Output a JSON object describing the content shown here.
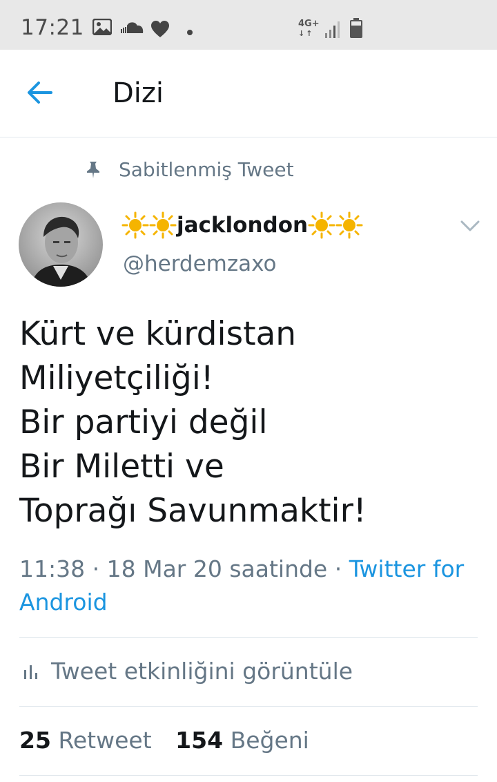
{
  "status_bar": {
    "time": "17:21",
    "network": "4G+",
    "icons": [
      "image-icon",
      "cloud-icon",
      "heart-icon",
      "dot-icon",
      "signal-icon",
      "battery-icon"
    ]
  },
  "header": {
    "title": "Dizi",
    "back_icon": "arrow-left-icon"
  },
  "tweet": {
    "pinned_label": "Sabitlenmiş Tweet",
    "display_name": "jacklondon",
    "handle": "@herdemzaxo",
    "text_lines": [
      "Kürt ve kürdistan",
      "Miliyetçiliği!",
      "Bir partiyi değil",
      "Bir Miletti ve",
      "Toprağı Savunmaktir!"
    ],
    "time": "11:38",
    "date": "18 Mar 20 saatinde",
    "separator": "·",
    "source_part1": "Twitter for",
    "source_part2": "Android",
    "activity_label": "Tweet etkinliğini görüntüle",
    "retweet_count": "25",
    "retweet_label": "Retweet",
    "like_count": "154",
    "like_label": "Beğeni"
  },
  "colors": {
    "accent": "#1b95e0",
    "secondary_text": "#657786",
    "primary_text": "#14171a",
    "sun_emoji": "#f5b400"
  }
}
